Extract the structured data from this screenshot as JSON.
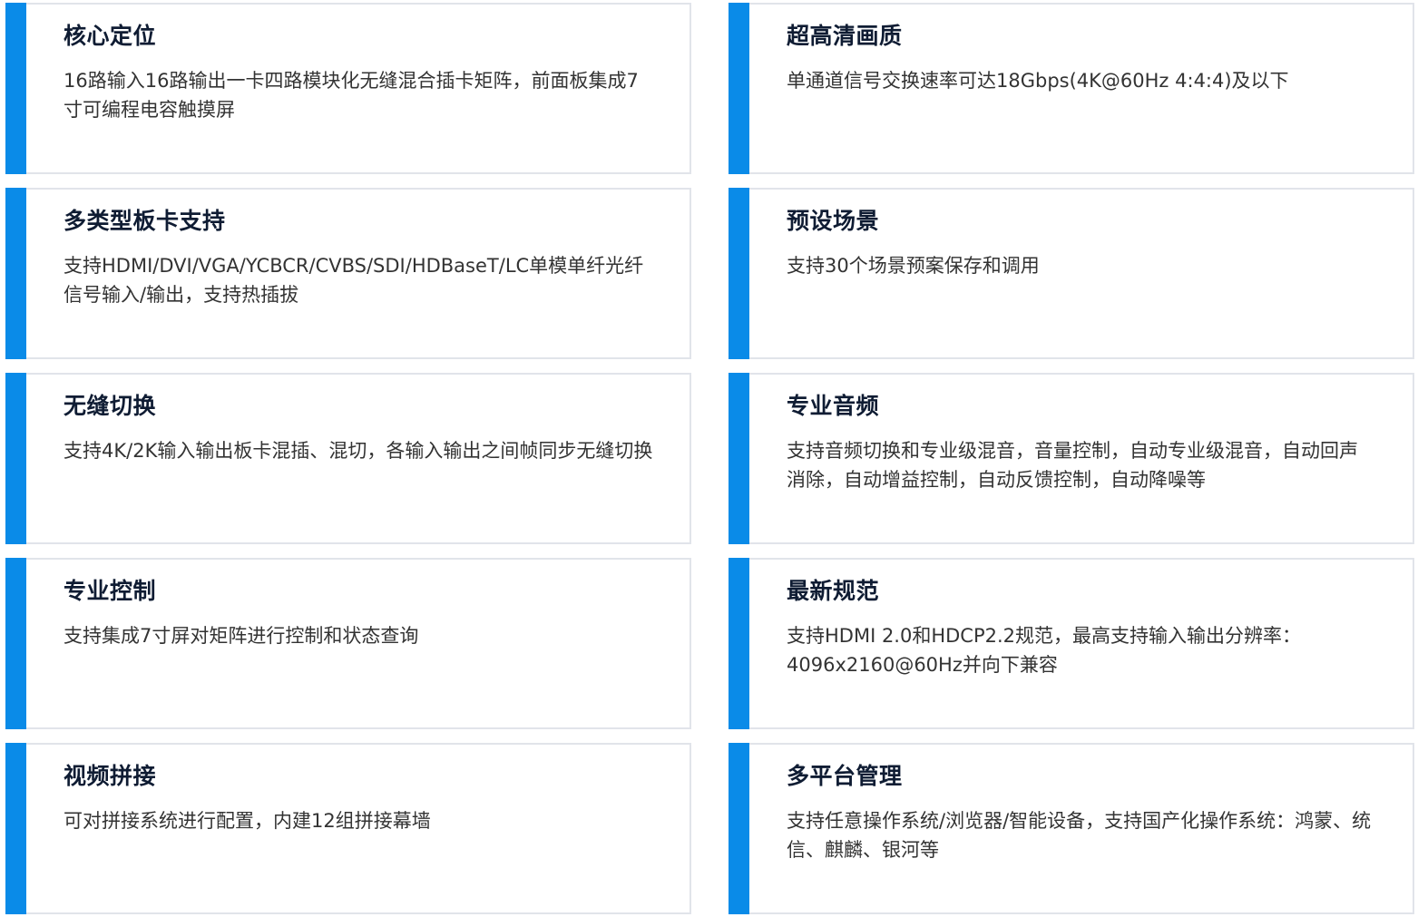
{
  "colors": {
    "accent": "#0a8be8",
    "title": "#0f1c33",
    "text": "#333333",
    "border": "#e1e4ea"
  },
  "features": [
    {
      "title": "核心定位",
      "desc": "16路输入16路输出一卡四路模块化无缝混合插卡矩阵，前面板集成7寸可编程电容触摸屏"
    },
    {
      "title": "超高清画质",
      "desc": "单通道信号交换速率可达18Gbps(4K@60Hz 4:4:4)及以下"
    },
    {
      "title": "多类型板卡支持",
      "desc": "支持HDMI/DVI/VGA/YCBCR/CVBS/SDI/HDBaseT/LC单模单纤光纤信号输入/输出，支持热插拔"
    },
    {
      "title": "预设场景",
      "desc": "支持30个场景预案保存和调用"
    },
    {
      "title": "无缝切换",
      "desc": "支持4K/2K输入输出板卡混插、混切，各输入输出之间帧同步无缝切换"
    },
    {
      "title": "专业音频",
      "desc": "支持音频切换和专业级混音，音量控制，自动专业级混音，自动回声消除，自动增益控制，自动反馈控制，自动降噪等"
    },
    {
      "title": "专业控制",
      "desc": "支持集成7寸屏对矩阵进行控制和状态查询"
    },
    {
      "title": "最新规范",
      "desc": "支持HDMI 2.0和HDCP2.2规范，最高支持输入输出分辨率：4096x2160@60Hz并向下兼容"
    },
    {
      "title": "视频拼接",
      "desc": "可对拼接系统进行配置，内建12组拼接幕墙"
    },
    {
      "title": "多平台管理",
      "desc": "支持任意操作系统/浏览器/智能设备，支持国产化操作系统：鸿蒙、统信、麒麟、银河等"
    }
  ]
}
